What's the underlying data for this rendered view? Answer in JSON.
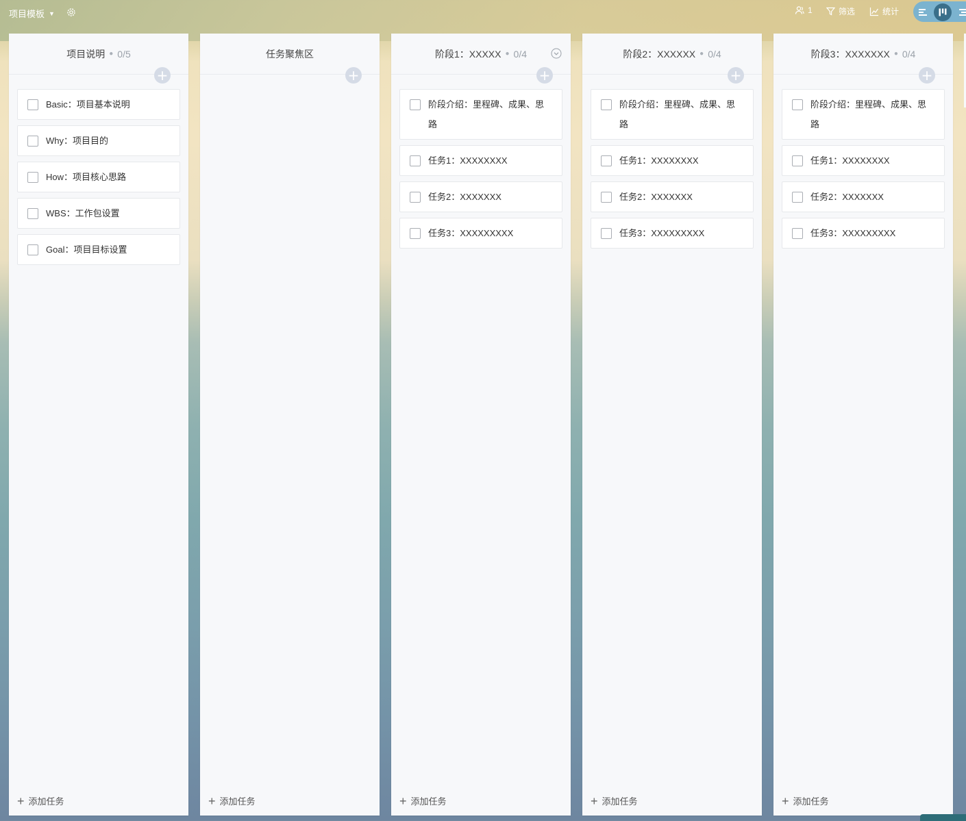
{
  "header": {
    "project_title": "项目模板",
    "members_count": "1",
    "filter_label": "筛选",
    "stats_label": "统计",
    "icons": [
      "settings-icon",
      "members-icon",
      "filter-icon",
      "stats-icon",
      "gantt-view-icon",
      "board-view-icon",
      "list-view-icon"
    ]
  },
  "columns": [
    {
      "title": "项目说明",
      "count": "0/5",
      "cards": [
        "Basic：项目基本说明",
        "Why：项目目的",
        "How：项目核心思路",
        "WBS：工作包设置",
        "Goal：项目目标设置"
      ],
      "add_label": "添加任务"
    },
    {
      "title": "任务聚焦区",
      "count": "",
      "cards": [],
      "add_label": "添加任务"
    },
    {
      "title": "阶段1：XXXXX",
      "count": "0/4",
      "cards": [
        "阶段介绍：里程碑、成果、思路",
        "任务1：XXXXXXXX",
        "任务2：XXXXXXX",
        "任务3：XXXXXXXXX"
      ],
      "add_label": "添加任务"
    },
    {
      "title": "阶段2：XXXXXX",
      "count": "0/4",
      "cards": [
        "阶段介绍：里程碑、成果、思路",
        "任务1：XXXXXXXX",
        "任务2：XXXXXXX",
        "任务3：XXXXXXXXX"
      ],
      "add_label": "添加任务"
    },
    {
      "title": "阶段3：XXXXXXX",
      "count": "0/4",
      "cards": [
        "阶段介绍：里程碑、成果、思路",
        "任务1：XXXXXXXX",
        "任务2：XXXXXXX",
        "任务3：XXXXXXXXX"
      ],
      "add_label": "添加任务"
    }
  ]
}
